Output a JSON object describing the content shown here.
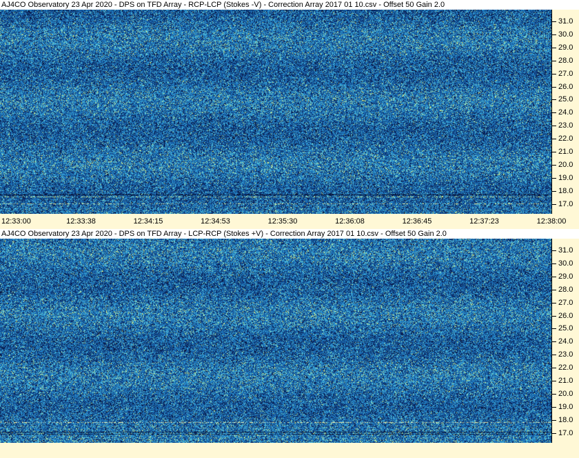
{
  "panels": [
    {
      "title": "AJ4CO Observatory 23 Apr 2020  -  DPS on TFD Array  -  RCP-LCP (Stokes -V)  -  Correction Array 2017 01 10.csv  -  Offset 50  Gain 2.0",
      "y_labels": [
        "31.0",
        "30.0",
        "29.0",
        "28.0",
        "27.0",
        "26.0",
        "25.0",
        "24.0",
        "23.0",
        "22.0",
        "21.0",
        "20.0",
        "19.0",
        "18.0",
        "17.0"
      ],
      "x_labels": [
        "12:33:00",
        "12:33:38",
        "12:34:15",
        "12:34:53",
        "12:35:30",
        "12:36:08",
        "12:36:45",
        "12:37:23",
        "12:38:00"
      ]
    },
    {
      "title": "AJ4CO Observatory 23 Apr 2020  -  DPS on TFD Array  -  LCP-RCP (Stokes +V)  -  Correction Array 2017 01 10.csv  -  Offset 50  Gain 2.0",
      "y_labels": [
        "31.0",
        "30.0",
        "29.0",
        "28.0",
        "27.0",
        "26.0",
        "25.0",
        "24.0",
        "23.0",
        "22.0",
        "21.0",
        "20.0",
        "19.0",
        "18.0",
        "17.0"
      ]
    }
  ],
  "colors": {
    "background": "#fff8d6",
    "spectrogram_base": "#1a5f9e",
    "noise_low": "#0a1a4a",
    "noise_mid": "#1f7fc8",
    "noise_high": "#4fd0e0",
    "noise_peak": "#e8f080"
  }
}
